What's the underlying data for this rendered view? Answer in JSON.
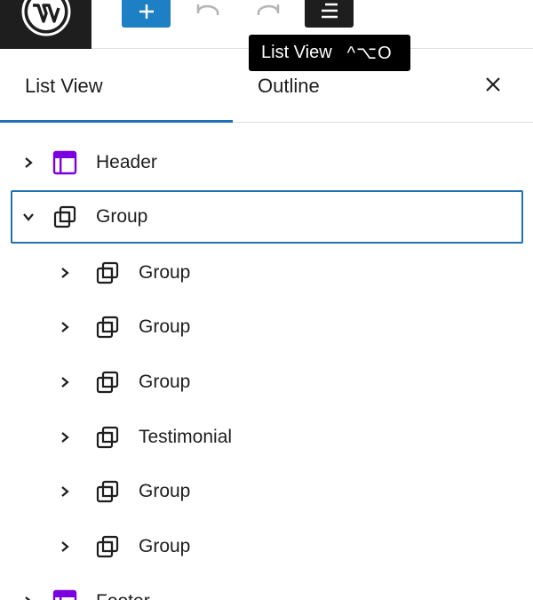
{
  "toolbar": {
    "logo_icon": "wordpress-logo-icon",
    "add_icon": "plus-icon",
    "undo_icon": "undo-icon",
    "redo_icon": "redo-icon",
    "list_view_icon": "list-view-icon"
  },
  "tooltip": {
    "label": "List View",
    "shortcut": "^⌥O"
  },
  "tabs": [
    {
      "label": "List View",
      "active": true
    },
    {
      "label": "Outline",
      "active": false
    }
  ],
  "close_icon": "close-icon",
  "colors": {
    "accent": "#2271b1",
    "add_button": "#1d7fc4",
    "template_part": "#7a00df",
    "dark": "#1e1e1e"
  },
  "tree": [
    {
      "label": "Header",
      "icon": "template-part-icon",
      "expanded": false,
      "level": 1
    },
    {
      "label": "Group",
      "icon": "group-icon",
      "expanded": true,
      "level": 1,
      "selected": true
    },
    {
      "label": "Group",
      "icon": "group-icon",
      "expanded": false,
      "level": 2
    },
    {
      "label": "Group",
      "icon": "group-icon",
      "expanded": false,
      "level": 2
    },
    {
      "label": "Group",
      "icon": "group-icon",
      "expanded": false,
      "level": 2
    },
    {
      "label": "Testimonial",
      "icon": "group-icon",
      "expanded": false,
      "level": 2
    },
    {
      "label": "Group",
      "icon": "group-icon",
      "expanded": false,
      "level": 2
    },
    {
      "label": "Group",
      "icon": "group-icon",
      "expanded": false,
      "level": 2
    },
    {
      "label": "Footer",
      "icon": "template-part-icon",
      "expanded": false,
      "level": 1
    }
  ]
}
